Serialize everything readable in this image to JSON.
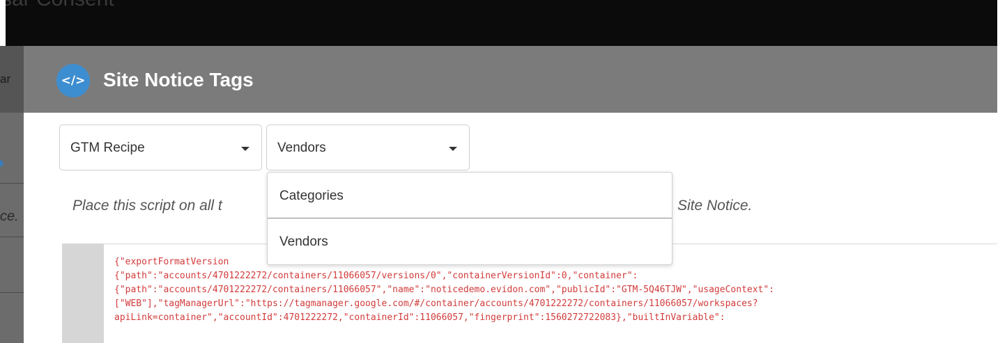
{
  "background": {
    "app_title": "sar Consent",
    "sidebar_text_1": "ar",
    "sidebar_text_2": "ce."
  },
  "modal": {
    "icon": "code-icon",
    "icon_glyph": "</>",
    "title": "Site Notice Tags",
    "recipe_select": {
      "value": "GTM Recipe"
    },
    "type_select": {
      "value": "Vendors"
    },
    "instructions_left": "Place this script on all t",
    "instructions_right": "Site Notice.",
    "dropdown_options": [
      "Categories",
      "Vendors"
    ],
    "code_lines": [
      "{\"exportFormatVersion                                                    on\":",
      "{\"path\":\"accounts/4701222272/containers/11066057/versions/0\",\"containerVersionId\":0,\"container\":",
      "{\"path\":\"accounts/4701222272/containers/11066057\",\"name\":\"noticedemo.evidon.com\",\"publicId\":\"GTM-5Q46TJW\",\"usageContext\":",
      "[\"WEB\"],\"tagManagerUrl\":\"https://tagmanager.google.com/#/container/accounts/4701222272/containers/11066057/workspaces?",
      "apiLink=container\",\"accountId\":4701222272,\"containerId\":11066057,\"fingerprint\":1560272722083},\"builtInVariable\":"
    ]
  },
  "colors": {
    "header_bg": "#7b7b7b",
    "icon_bg": "#3d8ed0",
    "code_text": "#d23b3b"
  }
}
